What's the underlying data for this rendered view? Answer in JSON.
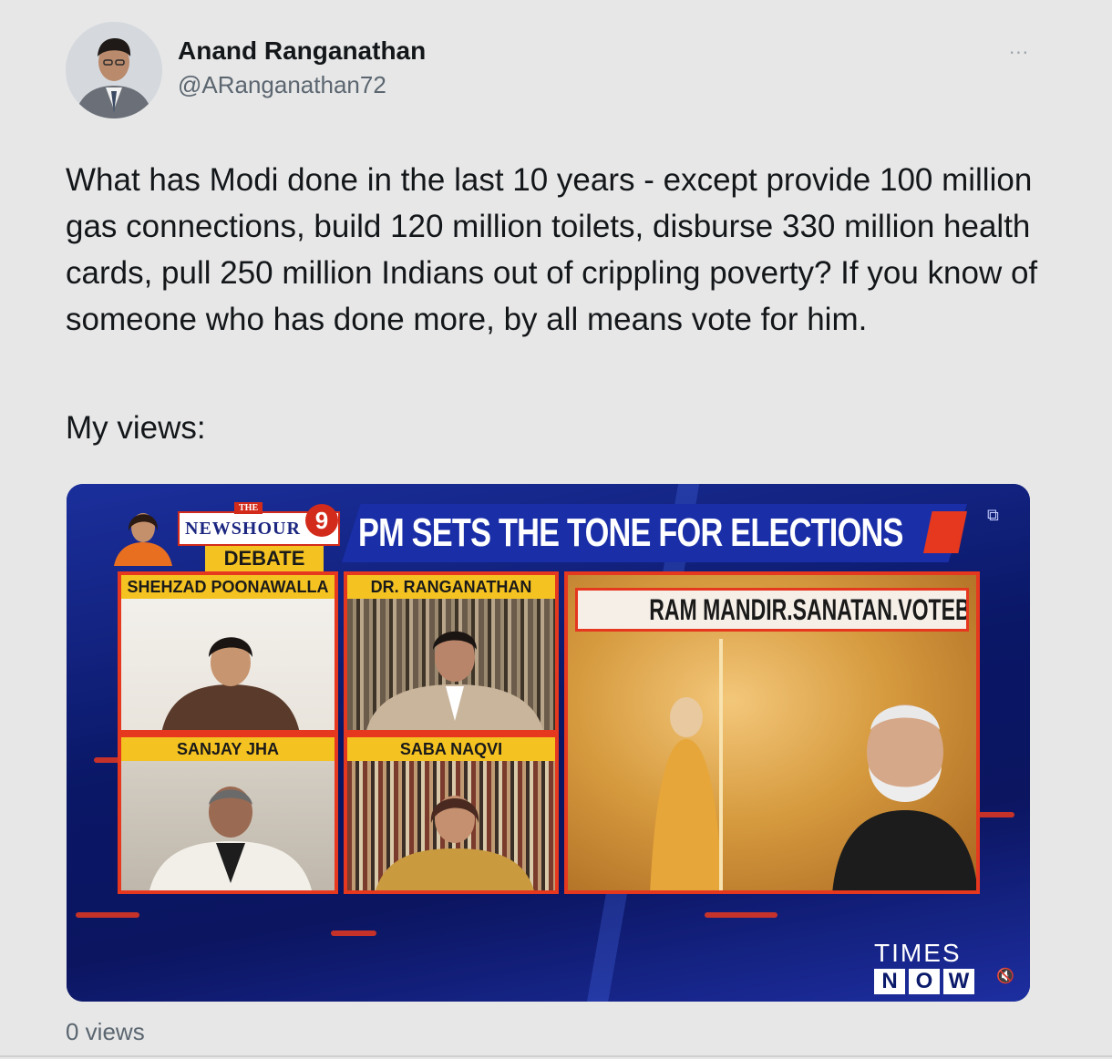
{
  "author": {
    "display_name": "Anand Ranganathan",
    "handle": "@ARanganathan72"
  },
  "more_menu": {
    "label": "···"
  },
  "tweet": {
    "text": "What has Modi done in the last 10 years - except provide 100 million gas connections, build 120 million toilets, disburse 330 million health cards, pull 250 million Indians out of crippling poverty? If you know of someone who has done more, by all means vote for him.",
    "subtext": "My views:"
  },
  "video": {
    "show_logo_the": "THE",
    "show_logo_name": "NEWSHOUR",
    "show_logo_number": "9",
    "show_logo_sub": "DEBATE",
    "headline": "PM SETS THE TONE FOR ELECTIONS",
    "panels": [
      {
        "label": "SHEHZAD POONAWALLA"
      },
      {
        "label": "DR. RANGANATHAN"
      },
      {
        "label": "SANJAY JHA"
      },
      {
        "label": "SABA NAQVI"
      }
    ],
    "big_panel_label": "RAM MANDIR.SANATAN.VOTEBANK",
    "channel_times": "TIMES",
    "channel_now": [
      "N",
      "O",
      "W"
    ],
    "accent_color": "#e6371f",
    "label_color": "#f5c321",
    "bg_color": "#0b1a6b"
  },
  "stats": {
    "views": "0 views"
  }
}
